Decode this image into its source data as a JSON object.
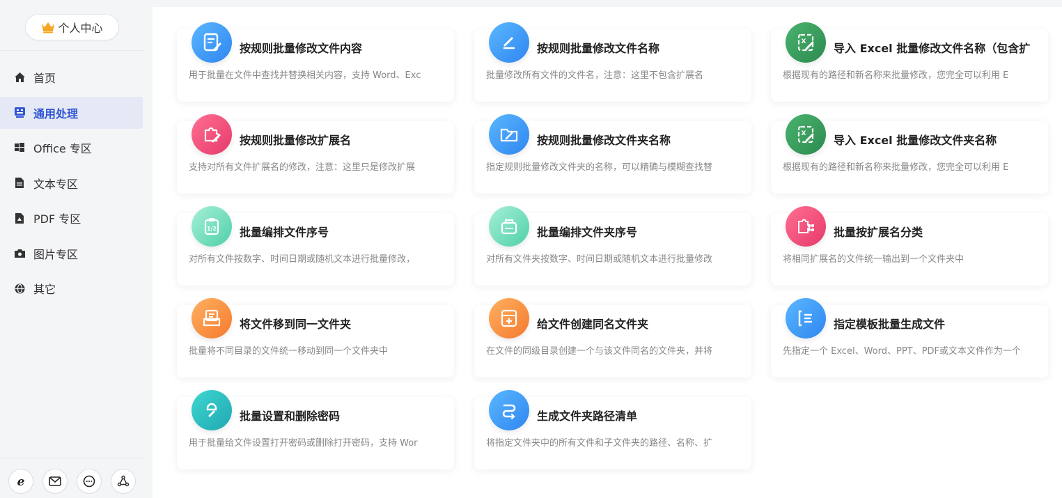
{
  "sidebar": {
    "profile_label": "个人中心",
    "items": [
      {
        "label": "首页",
        "icon": "home-icon"
      },
      {
        "label": "通用处理",
        "icon": "grid-icon",
        "active": true
      },
      {
        "label": "Office 专区",
        "icon": "windows-icon"
      },
      {
        "label": "文本专区",
        "icon": "document-icon"
      },
      {
        "label": "PDF 专区",
        "icon": "pdf-icon"
      },
      {
        "label": "图片专区",
        "icon": "camera-icon"
      },
      {
        "label": "其它",
        "icon": "globe-icon"
      }
    ],
    "footer_icons": [
      "ie-browser-icon",
      "mail-icon",
      "chat-icon",
      "share-network-icon"
    ]
  },
  "colors": {
    "accent": "#3055d6",
    "active_bg": "#e5e9f5"
  },
  "cards": [
    {
      "title": "按规则批量修改文件内容",
      "desc": "用于批量在文件中查找并替换相关内容，支持 Word、Exc",
      "icon": "edit-document-icon",
      "color": "blue"
    },
    {
      "title": "按规则批量修改文件名称",
      "desc": "批量修改所有文件的文件名，注意：这里不包含扩展名",
      "icon": "pencil-icon",
      "color": "blue"
    },
    {
      "title": "导入 Excel 批量修改文件名称（包含扩",
      "desc": "根据现有的路径和新名称来批量修改，您完全可以利用 E",
      "icon": "excel-edit-icon",
      "color": "green"
    },
    {
      "title": "按规则批量修改扩展名",
      "desc": "支持对所有文件扩展名的修改，注意：这里只是修改扩展",
      "icon": "puzzle-edit-icon",
      "color": "pink"
    },
    {
      "title": "按规则批量修改文件夹名称",
      "desc": "指定规则批量修改文件夹的名称，可以精确与模糊查找替",
      "icon": "folder-edit-icon",
      "color": "blue"
    },
    {
      "title": "导入 Excel 批量修改文件夹名称",
      "desc": "根据现有的路径和新名称来批量修改，您完全可以利用 E",
      "icon": "excel-folder-icon",
      "color": "green"
    },
    {
      "title": "批量编排文件序号",
      "desc": "对所有文件按数字、时间日期或随机文本进行批量修改，",
      "icon": "clipboard-number-icon",
      "color": "teal"
    },
    {
      "title": "批量编排文件夹序号",
      "desc": "对所有文件夹按数字、时间日期或随机文本进行批量修改",
      "icon": "folder-number-icon",
      "color": "teal"
    },
    {
      "title": "批量按扩展名分类",
      "desc": "将相同扩展名的文件统一输出到一个文件夹中",
      "icon": "category-icon",
      "color": "pink"
    },
    {
      "title": "将文件移到同一文件夹",
      "desc": "批量将不同目录的文件统一移动到同一个文件夹中",
      "icon": "move-to-folder-icon",
      "color": "orange"
    },
    {
      "title": "给文件创建同名文件夹",
      "desc": "在文件的同级目录创建一个与该文件同名的文件夹，并将",
      "icon": "create-folder-icon",
      "color": "orange"
    },
    {
      "title": "指定模板批量生成文件",
      "desc": "先指定一个 Excel、Word、PPT、PDF或文本文件作为一个",
      "icon": "template-list-icon",
      "color": "blue"
    },
    {
      "title": "批量设置和删除密码",
      "desc": "用于批量给文件设置打开密码或删除打开密码，支持 Wor",
      "icon": "key-icon",
      "color": "cyan"
    },
    {
      "title": "生成文件夹路径清单",
      "desc": "将指定文件夹中的所有文件和子文件夹的路径、名称、扩",
      "icon": "path-list-icon",
      "color": "blue"
    }
  ]
}
